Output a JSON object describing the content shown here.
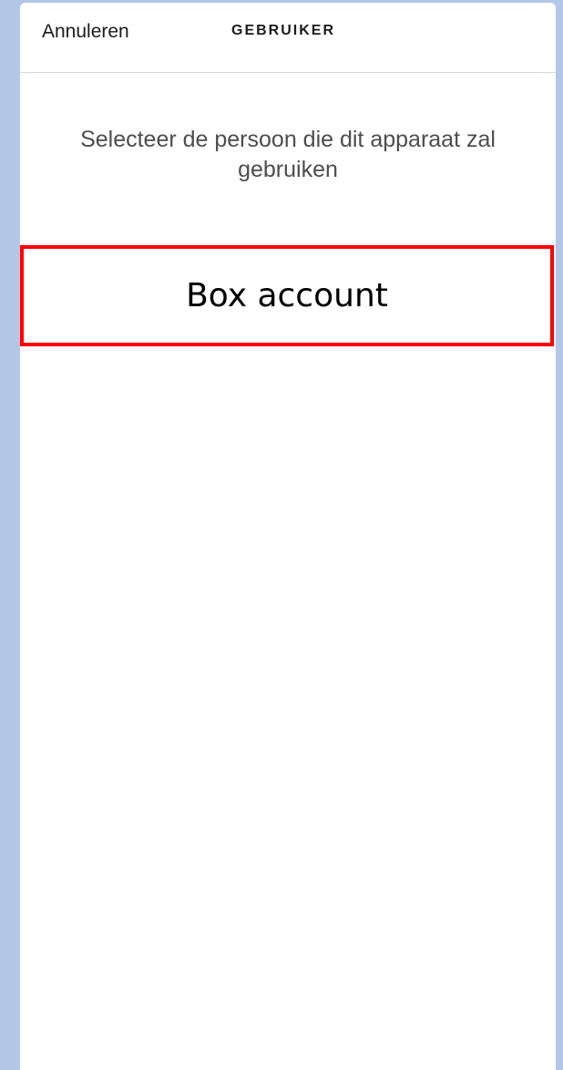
{
  "header": {
    "cancel_label": "Annuleren",
    "title": "GEBRUIKER"
  },
  "main": {
    "instruction": "Selecteer de persoon die dit apparaat zal gebruiken",
    "options": [
      {
        "label": "Box account"
      }
    ]
  },
  "colors": {
    "page_background": "#b4c7e7",
    "screen_background": "#ffffff",
    "highlight_border": "#ff0000",
    "instruction_text": "#4d4d4d"
  }
}
